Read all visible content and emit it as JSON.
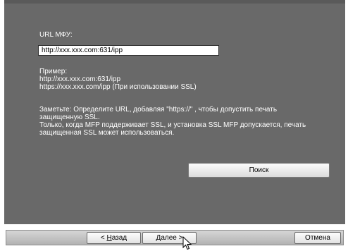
{
  "url_section": {
    "label": "URL МФУ:",
    "value": "http://xxx.xxx.com:631/ipp"
  },
  "example": {
    "heading": "Пример:",
    "line1": "http://xxx.xxx.com:631/ipp",
    "line2": "https://xxx.xxx.com/ipp (При использовании SSL)"
  },
  "note": {
    "line1": "Заметьте: Определите URL, добавляя \"https://\" , чтобы допустить печать",
    "line2": "защищенную SSL.",
    "line3": "Только, когда MFP поддерживает SSL, и установка SSL MFP допускается, печать",
    "line4": "защищенная SSL может использоваться."
  },
  "buttons": {
    "search": "Поиск",
    "back_prefix": "< ",
    "back_underlined": "Н",
    "back_rest": "азад",
    "next_underlined": "Д",
    "next_rest": "алее >",
    "cancel": "Отмена"
  },
  "icons": {
    "cursor": "mouse-pointer-icon"
  }
}
